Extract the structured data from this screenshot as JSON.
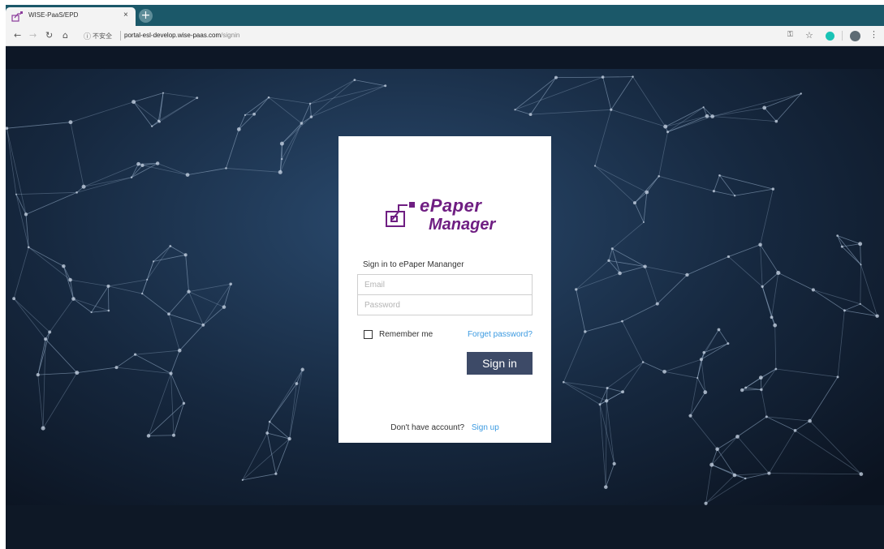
{
  "browser": {
    "tab_title": "WISE-PaaS/EPD",
    "tab_close": "×",
    "new_tab": "+",
    "security_label": "不安全",
    "url_host": "portal-esl-develop.wise-paas.com",
    "url_path": "/signin",
    "icons": [
      "back-arrow-icon",
      "forward-arrow-icon",
      "reload-icon",
      "home-icon",
      "info-icon",
      "key-icon",
      "star-icon",
      "extension-icon",
      "avatar-icon",
      "menu-icon"
    ]
  },
  "login": {
    "logo_line1": "ePaper",
    "logo_line2": "Manager",
    "heading": "Sign in to ePaper Mananger",
    "email_placeholder": "Email",
    "password_placeholder": "Password",
    "remember_label": "Remember me",
    "remember_checked": false,
    "forget_label": "Forget password?",
    "signin_label": "Sign in",
    "no_account_text": "Don't have account?",
    "signup_label": "Sign up"
  },
  "colors": {
    "tab_strip": "#1b5869",
    "brand_purple": "#6f1e82",
    "link_blue": "#3b9ae1",
    "button_navy": "#3d4a67",
    "background_dark": "#0f1a2a"
  }
}
